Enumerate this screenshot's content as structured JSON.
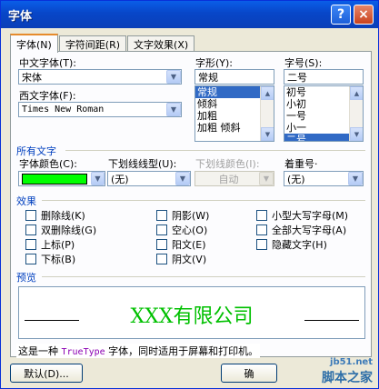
{
  "window": {
    "title": "字体",
    "help": "?",
    "close": "×"
  },
  "tabs": [
    {
      "label": "字体(N)",
      "active": true
    },
    {
      "label": "字符间距(R)",
      "active": false
    },
    {
      "label": "文字效果(X)",
      "active": false
    }
  ],
  "font": {
    "chinese_label": "中文字体(T):",
    "chinese_value": "宋体",
    "western_label": "西文字体(F):",
    "western_value": "Times New Roman",
    "style_label": "字形(Y):",
    "style_value": "常规",
    "style_options": [
      "常规",
      "倾斜",
      "加粗",
      "加粗 倾斜"
    ],
    "style_selected": "常规",
    "size_label": "字号(S):",
    "size_value": "二号",
    "size_options": [
      "初号",
      "小初",
      "一号",
      "小一",
      "二号"
    ],
    "size_selected": "二号"
  },
  "all_text": {
    "section": "所有文字",
    "color_label": "字体颜色(C):",
    "color_value": "#00ff00",
    "underline_label": "下划线线型(U):",
    "underline_value": "(无)",
    "underline_color_label": "下划线颜色(I):",
    "underline_color_value": "自动",
    "emphasis_label": "着重号·",
    "emphasis_value": "(无)"
  },
  "effects": {
    "section": "效果",
    "items": [
      {
        "label": "删除线(K)",
        "checked": false
      },
      {
        "label": "双删除线(G)",
        "checked": false
      },
      {
        "label": "上标(P)",
        "checked": false
      },
      {
        "label": "下标(B)",
        "checked": false
      },
      {
        "label": "阴影(W)",
        "checked": false
      },
      {
        "label": "空心(O)",
        "checked": false
      },
      {
        "label": "阳文(E)",
        "checked": false
      },
      {
        "label": "阴文(V)",
        "checked": false
      },
      {
        "label": "小型大写字母(M)",
        "checked": false
      },
      {
        "label": "全部大写字母(A)",
        "checked": false
      },
      {
        "label": "隐藏文字(H)",
        "checked": false
      }
    ]
  },
  "preview": {
    "section": "预览",
    "sample": "XXX有限公司",
    "note_prefix": "这是一种 ",
    "note_font": "TrueType",
    "note_suffix": " 字体，同时适用于屏幕和打印机。"
  },
  "buttons": {
    "default": "默认(D)...",
    "ok": "确"
  },
  "watermark": {
    "site": "jb51.net",
    "brand": "脚本之家"
  }
}
